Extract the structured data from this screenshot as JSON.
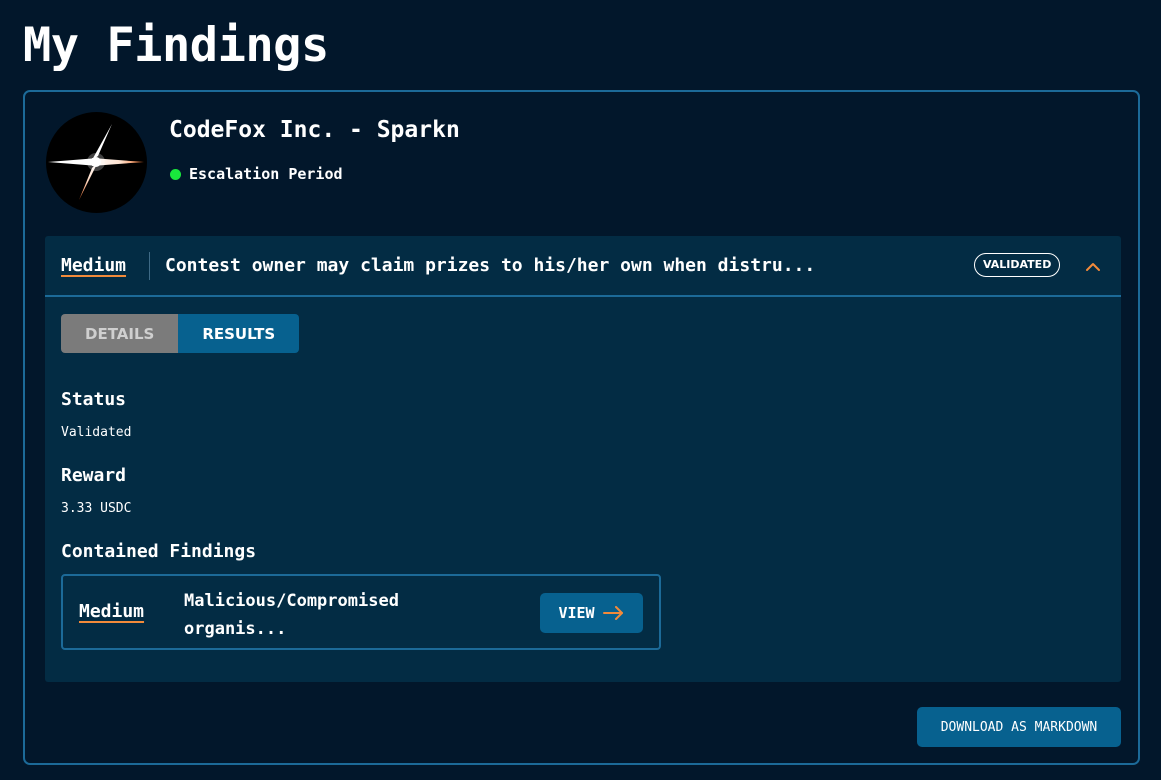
{
  "page": {
    "title": "My Findings"
  },
  "contest": {
    "name": "CodeFox Inc. - Sparkn",
    "status": "Escalation Period",
    "status_color": "#19e83c",
    "logo_icon": "four-point-star-icon"
  },
  "finding": {
    "severity": "Medium",
    "title": "Contest owner may claim prizes to his/her own when distru...",
    "badge": "VALIDATED",
    "toggle_icon": "chevron-up-icon",
    "tabs": [
      {
        "label": "DETAILS",
        "active": false
      },
      {
        "label": "RESULTS",
        "active": true
      }
    ],
    "results": {
      "status_label": "Status",
      "status_value": "Validated",
      "reward_label": "Reward",
      "reward_value": "3.33 USDC",
      "contained_label": "Contained Findings",
      "contained": [
        {
          "severity": "Medium",
          "title": "Malicious/Compromised organis...",
          "button_label": "VIEW",
          "button_icon": "arrow-right-icon"
        }
      ]
    }
  },
  "actions": {
    "download_label": "DOWNLOAD AS MARKDOWN"
  },
  "colors": {
    "background": "#02172b",
    "panel": "#032c44",
    "accent_button": "#07618f",
    "border": "#1c6a98",
    "severity_underline": "#f28a3a"
  }
}
